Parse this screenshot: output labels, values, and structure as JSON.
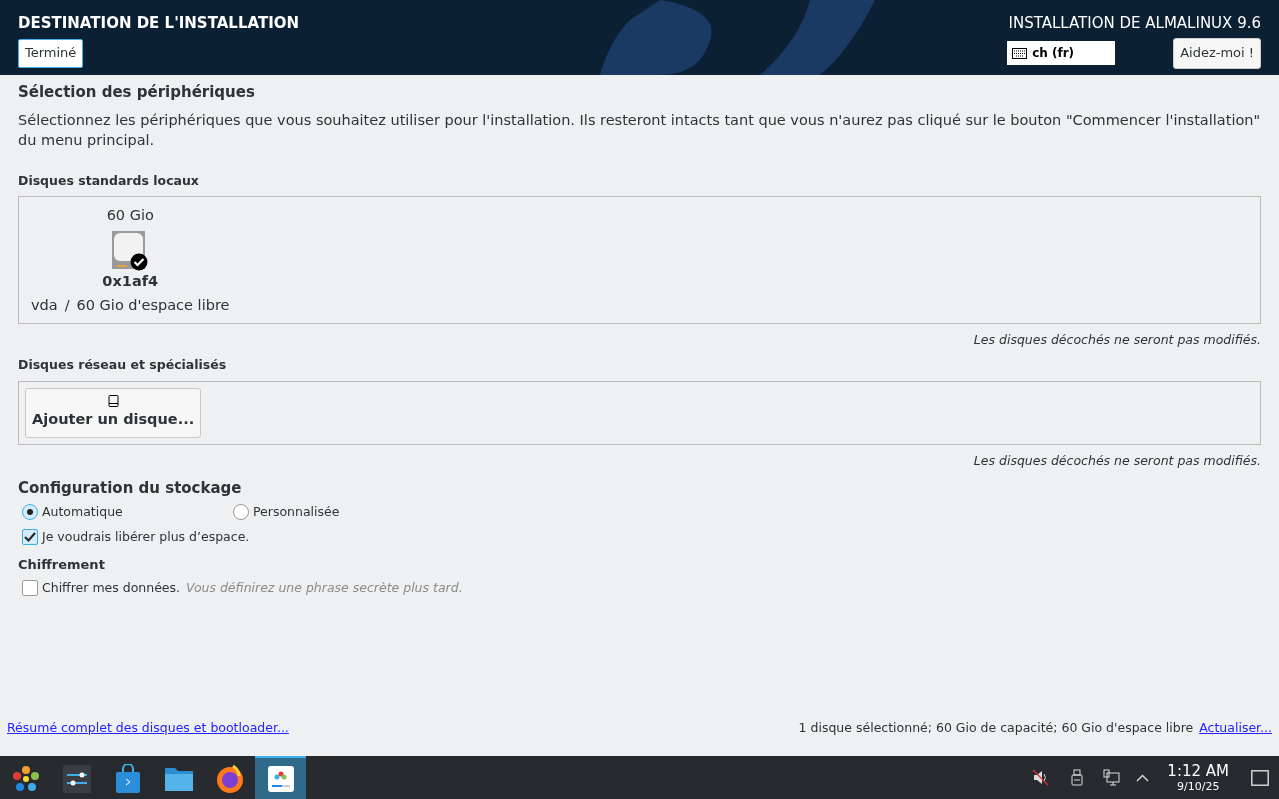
{
  "header": {
    "title": "DESTINATION DE L'INSTALLATION",
    "done_button": "Terminé",
    "product_title": "INSTALLATION DE ALMALINUX 9.6",
    "keyboard_layout": "ch (fr)",
    "help_button": "Aidez-moi !"
  },
  "device_selection": {
    "heading": "Sélection des périphériques",
    "description": "Sélectionnez les périphériques que vous souhaitez utiliser pour l'installation. Ils resteront intacts tant que vous n'aurez pas cliqué sur le bouton \"Commencer l'installation\" du menu principal."
  },
  "local_disks": {
    "heading": "Disques standards locaux",
    "disks": [
      {
        "size": "60 Gio",
        "name": "0x1af4",
        "device": "vda",
        "separator": "/",
        "free": "60 Gio d'espace libre",
        "selected": true
      }
    ],
    "note": "Les disques décochés ne seront pas modifiés."
  },
  "network_disks": {
    "heading": "Disques réseau et spécialisés",
    "add_button": "Ajouter un disque...",
    "note": "Les disques décochés ne seront pas modifiés."
  },
  "storage_config": {
    "heading": "Configuration du stockage",
    "options": [
      {
        "label": "Automatique",
        "selected": true
      },
      {
        "label": "Personnalisée",
        "selected": false
      }
    ],
    "reclaim": {
      "label": "Je voudrais libérer plus d’espace.",
      "checked": true
    }
  },
  "encryption": {
    "heading": "Chiffrement",
    "encrypt": {
      "label": "Chiffrer mes données.",
      "checked": false,
      "hint": "Vous définirez une phrase secrète plus tard."
    }
  },
  "footer": {
    "summary_link": "Résumé complet des disques et bootloader...",
    "status": "1 disque sélectionné; 60 Gio de capacité; 60 Gio d'espace libre",
    "refresh_link": "Actualiser..."
  },
  "taskbar": {
    "apps": [
      {
        "kind": "launcher",
        "active": false
      },
      {
        "kind": "settings",
        "active": false
      },
      {
        "kind": "store",
        "active": false
      },
      {
        "kind": "files",
        "active": false
      },
      {
        "kind": "browser",
        "active": false
      },
      {
        "kind": "installer",
        "active": true
      }
    ],
    "clock": {
      "time": "1:12 AM",
      "date": "9/10/25"
    }
  }
}
